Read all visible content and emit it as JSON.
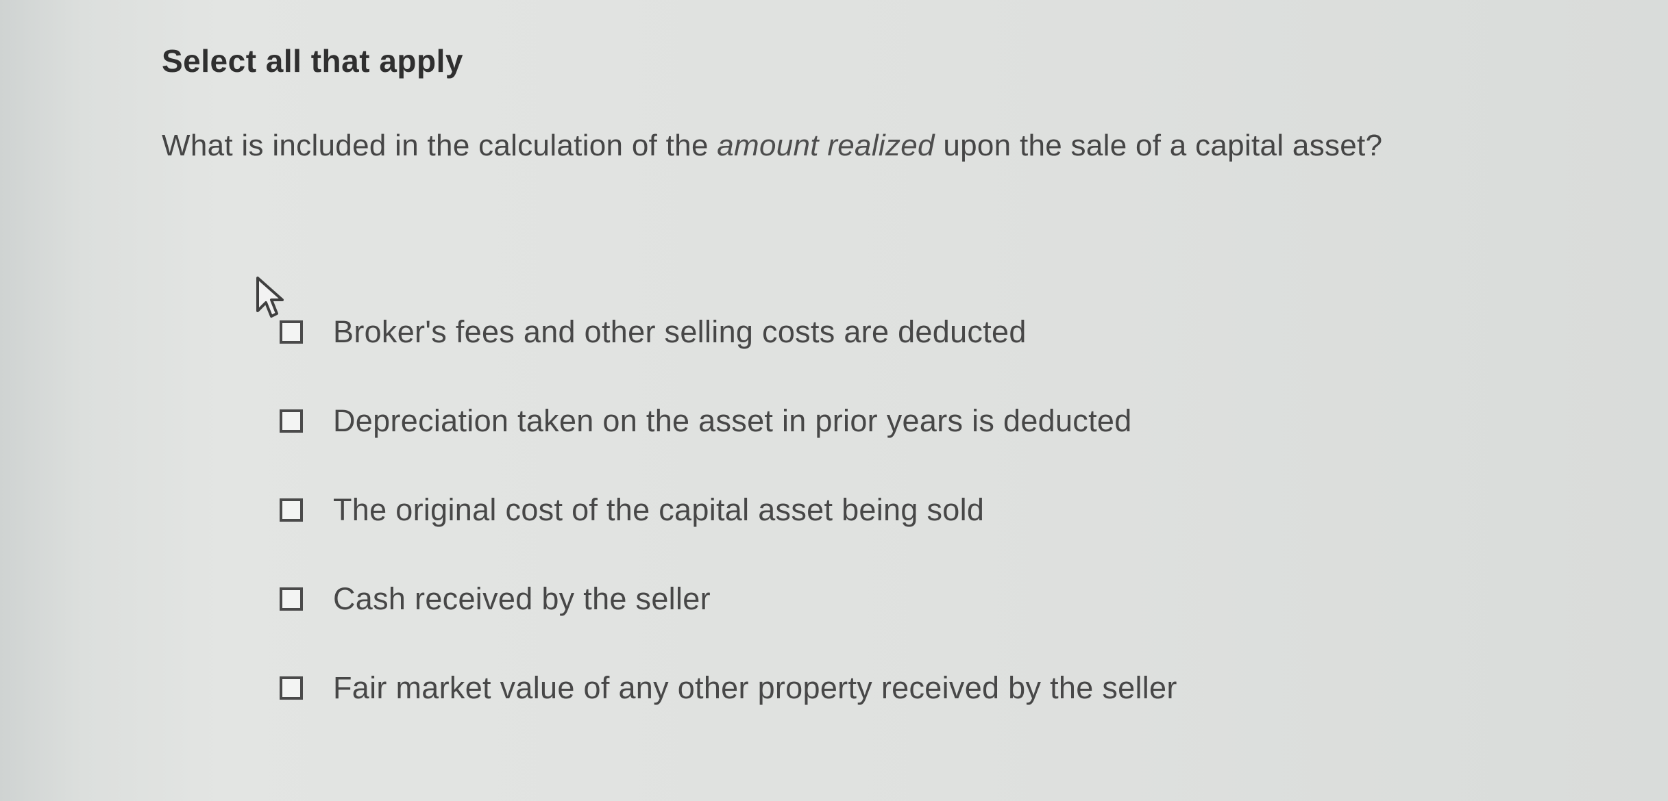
{
  "heading": "Select all that apply",
  "question": {
    "before": "What is included in the calculation of the ",
    "emphasis": "amount realized",
    "after": " upon the sale of a capital asset?"
  },
  "options": [
    {
      "label": "Broker's fees and other selling costs are deducted",
      "checked": false
    },
    {
      "label": "Depreciation taken on the asset in prior years is deducted",
      "checked": false
    },
    {
      "label": "The original cost of the capital asset being sold",
      "checked": false
    },
    {
      "label": "Cash received by the seller",
      "checked": false
    },
    {
      "label": "Fair market value of any other property received by the seller",
      "checked": false
    }
  ],
  "icons": {
    "cursor": "mouse-pointer-arrow-icon"
  }
}
